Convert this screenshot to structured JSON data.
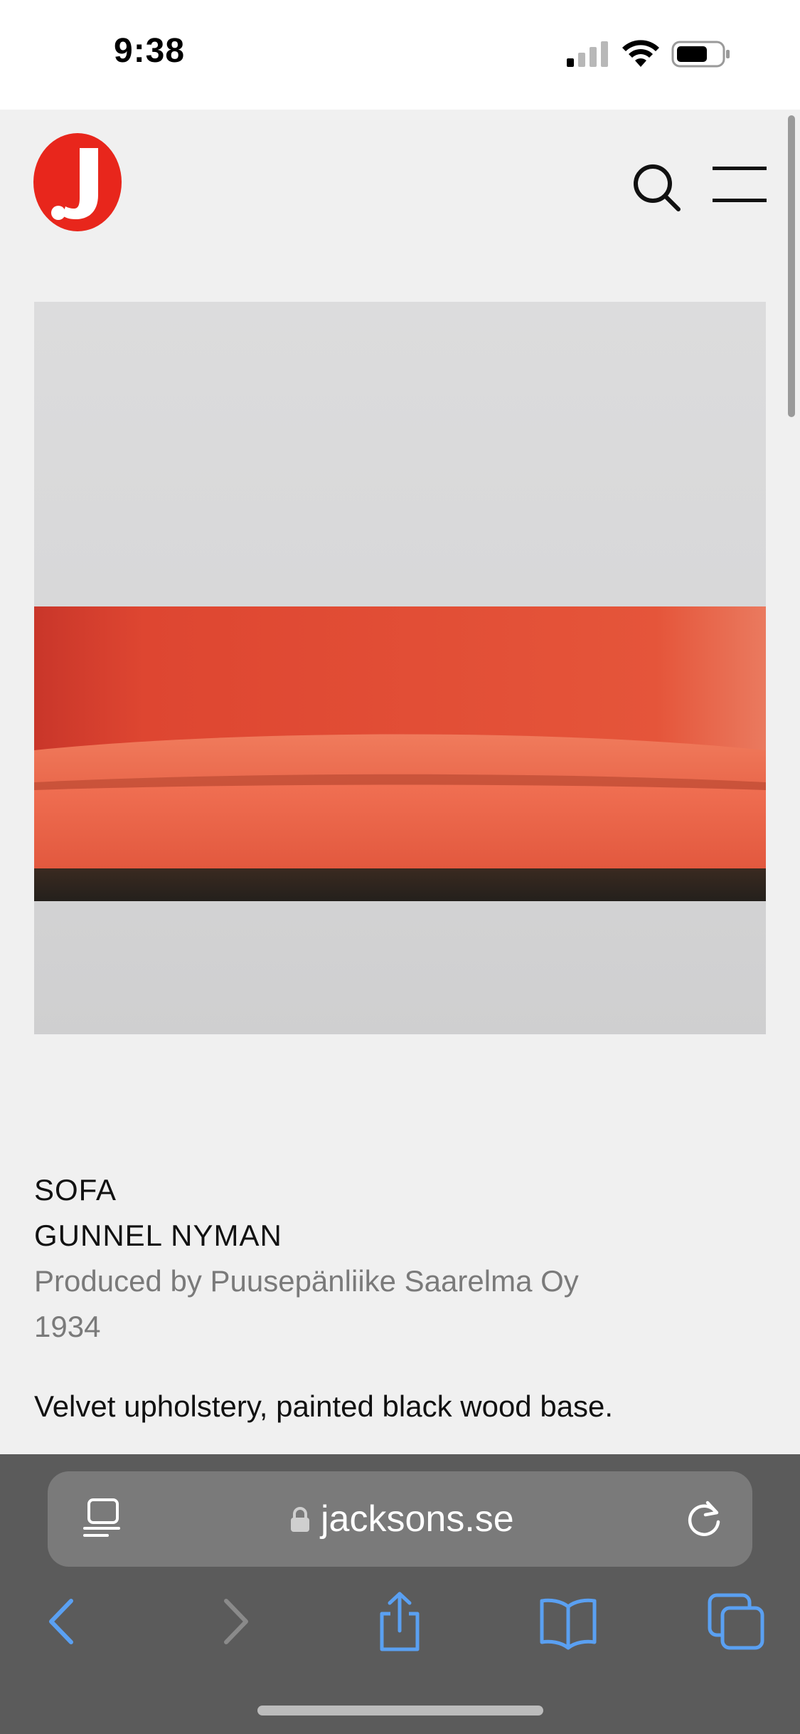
{
  "status_bar": {
    "time": "9:38"
  },
  "header": {
    "logo_letter": "J",
    "logo_color": "#e8261c"
  },
  "product": {
    "type": "SOFA",
    "designer": "GUNNEL NYMAN",
    "producer": "Produced by Puusepänliike Saarelma Oy",
    "year": "1934",
    "description": "Velvet upholstery, painted black wood base.",
    "upholstery_color": "#e5553a"
  },
  "browser": {
    "url": "jacksons.se",
    "accent_color": "#5aa0f2",
    "toolbar_icons": [
      "back-icon",
      "forward-icon",
      "share-icon",
      "bookmarks-icon",
      "tabs-icon"
    ]
  }
}
